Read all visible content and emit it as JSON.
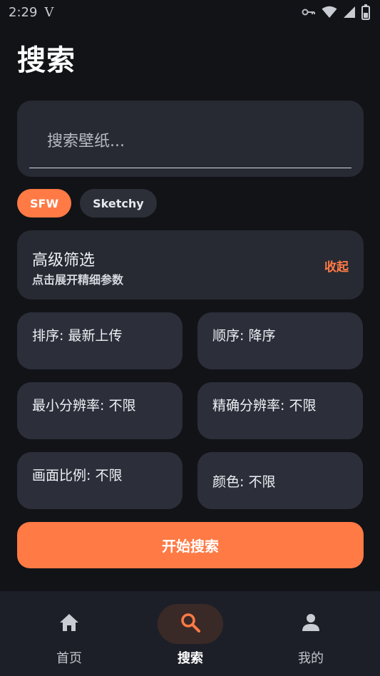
{
  "status_bar": {
    "time": "2:29",
    "carrier": "V",
    "icons": [
      "key-icon",
      "wifi-icon",
      "signal-icon",
      "battery-icon"
    ]
  },
  "page": {
    "title": "搜索"
  },
  "search": {
    "placeholder": "搜索壁纸...",
    "value": ""
  },
  "chips": [
    {
      "label": "SFW",
      "active": true
    },
    {
      "label": "Sketchy",
      "active": false
    }
  ],
  "filter": {
    "title": "高级筛选",
    "subtitle": "点击展开精细参数",
    "toggle_label": "收起"
  },
  "options": [
    {
      "label": "排序: 最新上传"
    },
    {
      "label": "顺序: 降序"
    },
    {
      "label": "最小分辨率: 不限"
    },
    {
      "label": "精确分辨率: 不限"
    },
    {
      "label": "画面比例: 不限"
    },
    {
      "label": "颜色: 不限"
    }
  ],
  "actions": {
    "search_button": "开始搜索"
  },
  "nav": {
    "items": [
      {
        "label": "首页",
        "icon": "home-icon",
        "active": false
      },
      {
        "label": "搜索",
        "icon": "search-icon",
        "active": true
      },
      {
        "label": "我的",
        "icon": "person-icon",
        "active": false
      }
    ]
  },
  "colors": {
    "background": "#111317",
    "card": "#272a33",
    "accent": "#ff7a45",
    "nav_background": "#1c1f27"
  }
}
